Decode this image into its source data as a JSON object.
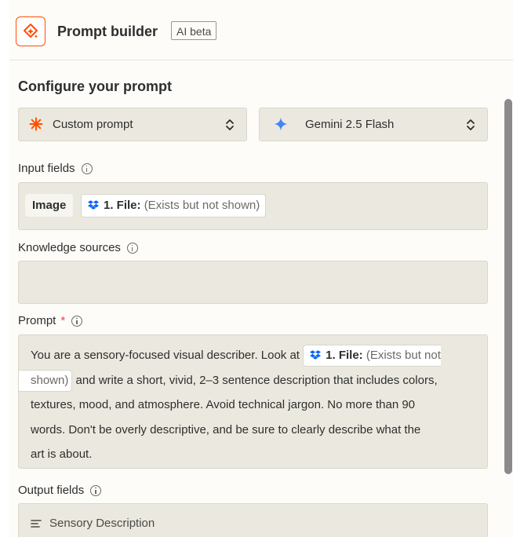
{
  "header": {
    "title": "Prompt builder",
    "badge": "AI beta",
    "logo_icon": "sparkle-diamond-icon"
  },
  "section_title": "Configure your prompt",
  "prompt_type_select": {
    "label": "Custom prompt",
    "icon": "asterisk-icon",
    "icon_color": "#ff4f00"
  },
  "model_select": {
    "label": "Gemini 2.5 Flash",
    "icon": "gemini-sparkle-icon",
    "icon_color": "#4285f4"
  },
  "input_fields": {
    "label": "Input fields",
    "field_name": "Image",
    "token": {
      "step": "1. File:",
      "value": "(Exists but not shown)",
      "icon": "dropbox-icon"
    }
  },
  "knowledge_sources": {
    "label": "Knowledge sources"
  },
  "prompt": {
    "label": "Prompt",
    "required_mark": "*",
    "line1_before": "You are a sensory-focused visual describer. Look at ",
    "token_step": "1. File:",
    "token_value_part1": "(Exists but not",
    "token_value_part2": "shown)",
    "line2_after": " and write a short, vivid, 2–3 sentence description that includes colors,",
    "line3": "textures, mood, and atmosphere. Avoid technical jargon. No more than 90",
    "line4": "words. Don't be overly descriptive, and be sure to clearly describe what the",
    "line5": "art is about."
  },
  "output_fields": {
    "label": "Output fields",
    "item": "Sensory Description",
    "item_icon": "text-lines-icon"
  },
  "colors": {
    "accent": "#ff4f00",
    "dropbox": "#0061fe",
    "field_bg": "#ebe9df",
    "required": "#e5484d"
  }
}
